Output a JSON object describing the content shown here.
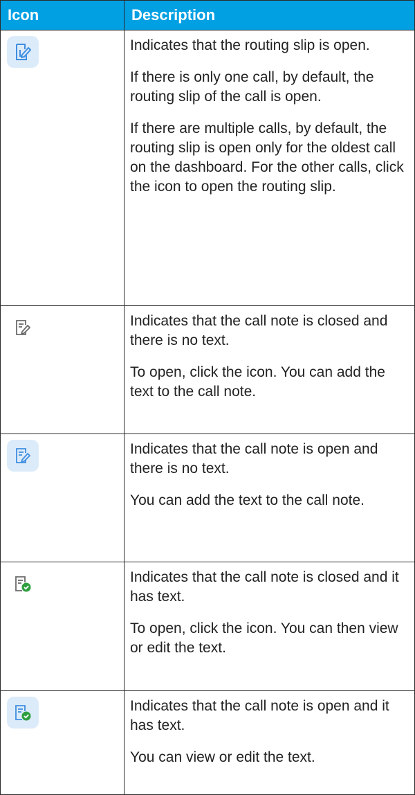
{
  "header": {
    "icon_col": "Icon",
    "desc_col": "Description"
  },
  "rows": [
    {
      "icon": "routing-slip-open-icon",
      "paragraphs": [
        "Indicates that the routing slip is open.",
        "If there is only one call, by default, the routing slip of the call is open.",
        "If there are multiple calls, by default, the routing slip is open only for the oldest call on the dashboard. For the other calls, click the icon to open the routing slip."
      ]
    },
    {
      "icon": "call-note-closed-empty-icon",
      "paragraphs": [
        "Indicates that the call note is closed and there is no text.",
        "To open, click the icon. You can add the text to the call note."
      ]
    },
    {
      "icon": "call-note-open-empty-icon",
      "paragraphs": [
        "Indicates that the call note is open and there is no text.",
        "You can add the text to the call note."
      ]
    },
    {
      "icon": "call-note-closed-text-icon",
      "paragraphs": [
        "Indicates that the call note is closed and it has text.",
        "To open, click the icon. You can then view or edit the text."
      ]
    },
    {
      "icon": "call-note-open-text-icon",
      "paragraphs": [
        "Indicates that the call note is open and it has text.",
        "You can view or edit the text."
      ]
    }
  ],
  "colors": {
    "header_bg": "#00A0E3",
    "header_text": "#ffffff",
    "icon_active_bg": "#dcebfa",
    "icon_blue": "#3f8ee0",
    "icon_gray": "#6b6b6b",
    "check_green": "#2e9e3f"
  }
}
